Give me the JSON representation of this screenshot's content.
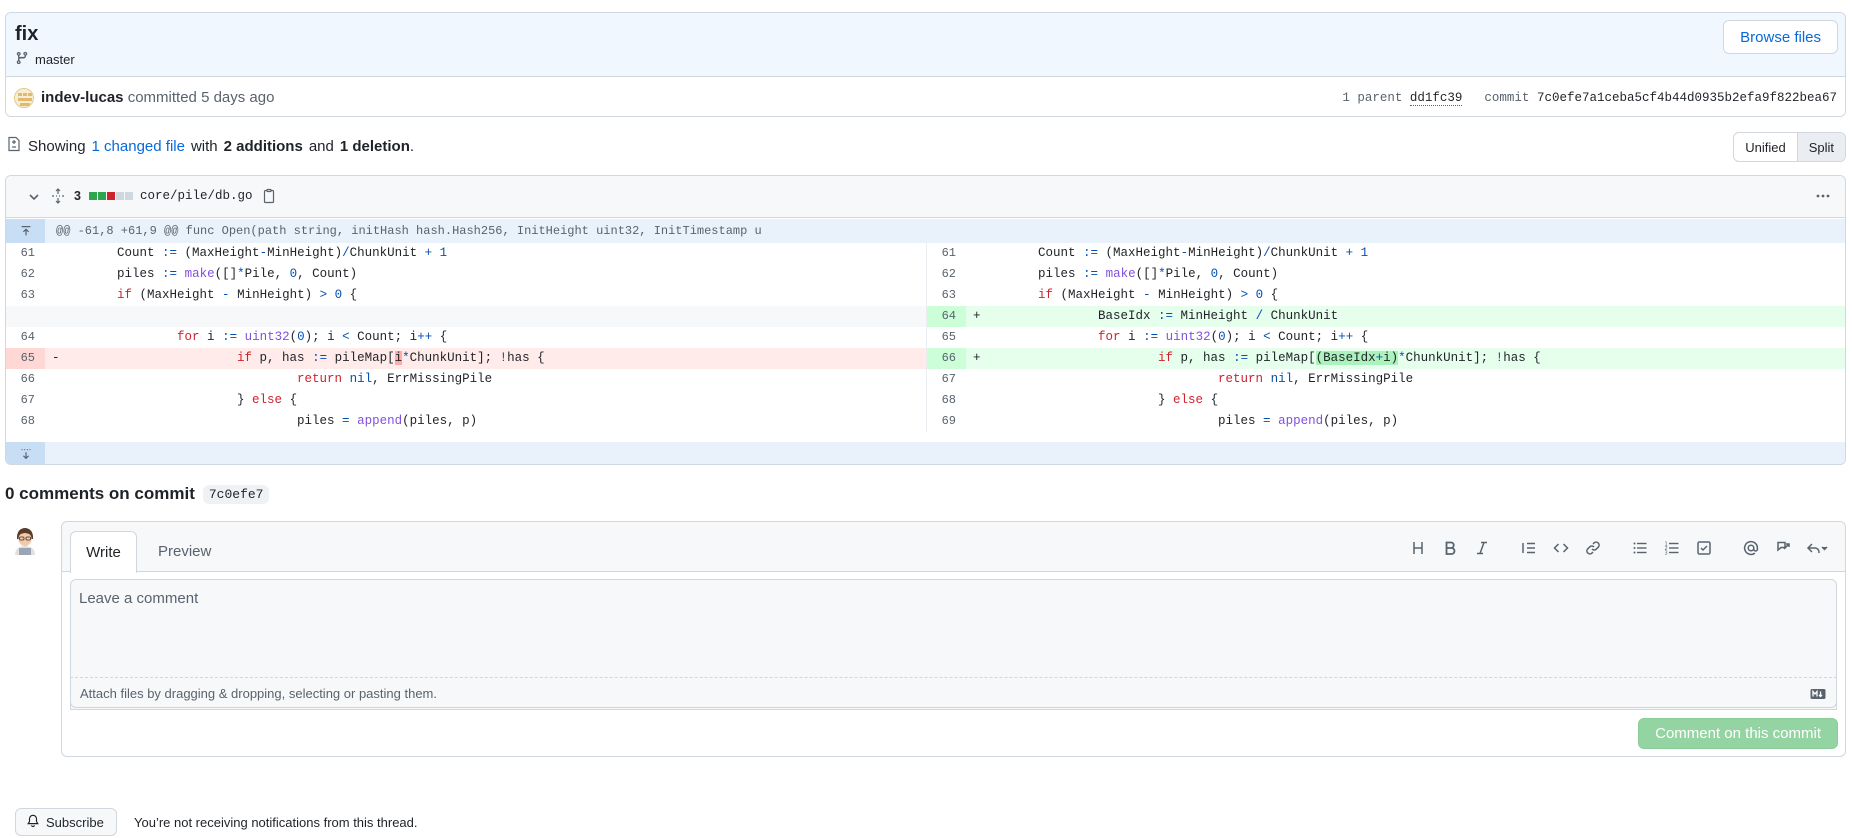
{
  "commit": {
    "title": "fix",
    "branch": "master",
    "browse_files": "Browse files",
    "author": "indev-lucas",
    "action": "committed",
    "time": "5 days ago",
    "parent_label": "1 parent",
    "parent_sha": "dd1fc39",
    "commit_label": "commit",
    "commit_sha": "7c0efe7a1ceba5cf4b44d0935b2efa9f822bea67"
  },
  "summary": {
    "showing": "Showing",
    "changed": "1 changed file",
    "with": "with",
    "additions": "2 additions",
    "and": "and",
    "deletions": "1 deletion",
    "period": "."
  },
  "view_toggle": {
    "unified": "Unified",
    "split": "Split",
    "selected": "Split"
  },
  "file": {
    "change_count": "3",
    "bars": [
      "#2da44e",
      "#2da44e",
      "#cf222e",
      "#d0d7de",
      "#d0d7de"
    ],
    "path": "core/pile/db.go",
    "hunk_header": "@@ -61,8 +61,9 @@ func Open(path string, initHash hash.Hash256, InitHeight uint32, InitTimestamp u"
  },
  "diff": {
    "rows": [
      {
        "l_num": "61",
        "l_type": "ctx",
        "r_num": "61",
        "r_type": "ctx"
      },
      {
        "l_num": "62",
        "l_type": "ctx",
        "r_num": "62",
        "r_type": "ctx"
      },
      {
        "l_num": "63",
        "l_type": "ctx",
        "r_num": "63",
        "r_type": "ctx"
      },
      {
        "l_num": "",
        "l_type": "empty",
        "r_num": "64",
        "r_type": "add"
      },
      {
        "l_num": "64",
        "l_type": "ctx",
        "r_num": "65",
        "r_type": "ctx"
      },
      {
        "l_num": "65",
        "l_type": "del",
        "r_num": "66",
        "r_type": "add"
      },
      {
        "l_num": "66",
        "l_type": "ctx",
        "r_num": "67",
        "r_type": "ctx"
      },
      {
        "l_num": "67",
        "l_type": "ctx",
        "r_num": "68",
        "r_type": "ctx"
      },
      {
        "l_num": "68",
        "l_type": "ctx",
        "r_num": "69",
        "r_type": "ctx"
      }
    ],
    "marker_del": "-",
    "marker_add": "+"
  },
  "comments": {
    "heading": "0 comments on commit",
    "sha": "7c0efe7",
    "tab_write": "Write",
    "tab_preview": "Preview",
    "placeholder": "Leave a comment",
    "attach_hint": "Attach files by dragging & dropping, selecting or pasting them.",
    "submit": "Comment on this commit"
  },
  "subscription": {
    "button": "Subscribe",
    "status": "You’re not receiving notifications from this thread."
  },
  "colors": {
    "link": "#0969da",
    "add_bg": "#e6ffec",
    "del_bg": "#ffebe9",
    "submit_disabled": "#94d3a2"
  }
}
